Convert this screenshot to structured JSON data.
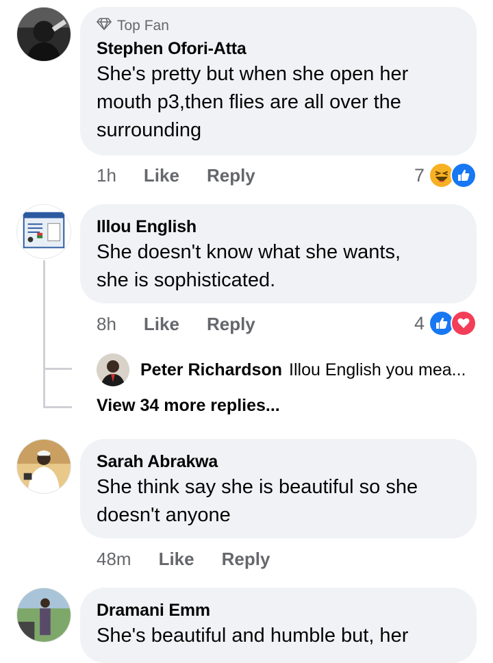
{
  "comments": [
    {
      "badge": "Top Fan",
      "author": "Stephen Ofori-Atta",
      "lines": [
        "She's pretty but when she open her",
        "mouth p3,then flies are all over the",
        "surrounding"
      ],
      "time": "1h",
      "like_label": "Like",
      "reply_label": "Reply",
      "reaction_count": "7",
      "reactions": [
        "haha-icon",
        "like-icon"
      ]
    },
    {
      "author": "Illou English",
      "lines": [
        "She doesn't know what she wants,",
        "she is sophisticated."
      ],
      "time": "8h",
      "like_label": "Like",
      "reply_label": "Reply",
      "reaction_count": "4",
      "reactions": [
        "like-icon",
        "love-icon"
      ],
      "reply_preview": {
        "author": "Peter Richardson",
        "text": "Illou English you mea..."
      },
      "view_more": "View 34 more replies..."
    },
    {
      "author": "Sarah Abrakwa",
      "lines": [
        "She think say she is beautiful so she",
        "doesn't anyone"
      ],
      "time": "48m",
      "like_label": "Like",
      "reply_label": "Reply"
    },
    {
      "author": "Dramani Emm",
      "lines": [
        "She's beautiful and humble but, her"
      ]
    }
  ],
  "colors": {
    "bubble": "#f0f2f5",
    "meta": "#65676b",
    "like_blue": "#1877f2",
    "love_red": "#f33e58",
    "haha_yellow": "#f7b125"
  }
}
